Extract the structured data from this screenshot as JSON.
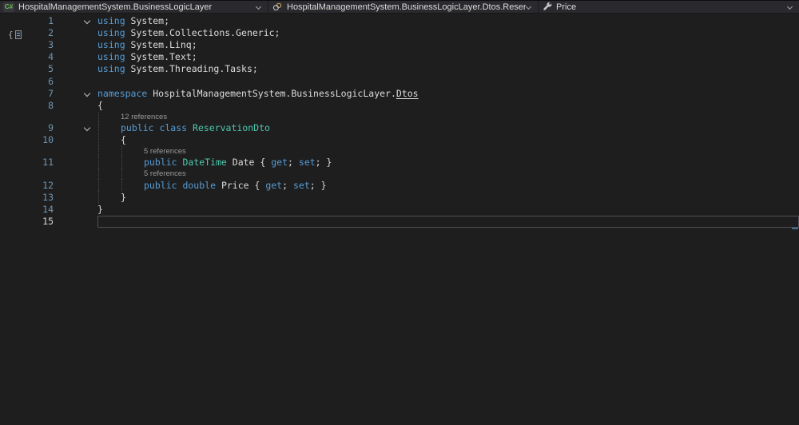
{
  "navbar": {
    "sections": [
      {
        "name": "project",
        "icon": "csharp-project-icon",
        "label": "HospitalManagementSystem.BusinessLogicLayer"
      },
      {
        "name": "type",
        "icon": "class-icon",
        "label": "HospitalManagementSystem.BusinessLogicLayer.Dtos.Reservation"
      },
      {
        "name": "member",
        "icon": "property-wrench-icon",
        "label": "Price"
      }
    ]
  },
  "editor": {
    "colors": {
      "background": "#1E1E1E",
      "keyword": "#569CD6",
      "type": "#4EC9B0",
      "plain": "#DCDCDC",
      "codelens": "#9A9A9A",
      "lineNumber": "#7096B0",
      "activeLineNumber": "#D4D4D4",
      "currentLineBorder": "#4F4F56"
    },
    "rows": [
      {
        "line": "1",
        "fold": true,
        "guides": 0,
        "tokens": [
          {
            "t": "using ",
            "c": "keyword"
          },
          {
            "t": "System;",
            "c": "plain"
          }
        ]
      },
      {
        "line": "2",
        "guides": 0,
        "tokens": [
          {
            "t": "using ",
            "c": "keyword"
          },
          {
            "t": "System.Collections.Generic;",
            "c": "plain"
          }
        ]
      },
      {
        "line": "3",
        "guides": 0,
        "tokens": [
          {
            "t": "using ",
            "c": "keyword"
          },
          {
            "t": "System.Linq;",
            "c": "plain"
          }
        ]
      },
      {
        "line": "4",
        "guides": 0,
        "tokens": [
          {
            "t": "using ",
            "c": "keyword"
          },
          {
            "t": "System.Text;",
            "c": "plain"
          }
        ]
      },
      {
        "line": "5",
        "guides": 0,
        "tokens": [
          {
            "t": "using ",
            "c": "keyword"
          },
          {
            "t": "System.Threading.Tasks;",
            "c": "plain"
          }
        ]
      },
      {
        "line": "6",
        "guides": 0,
        "tokens": []
      },
      {
        "line": "7",
        "fold": true,
        "guides": 0,
        "tokens": [
          {
            "t": "namespace ",
            "c": "keyword"
          },
          {
            "t": "HospitalManagementSystem.BusinessLogicLayer.",
            "c": "plain"
          },
          {
            "t": "Dtos",
            "c": "plain",
            "u": true
          }
        ]
      },
      {
        "line": "8",
        "guides": 0,
        "tokens": [
          {
            "t": "{",
            "c": "plain"
          }
        ]
      },
      {
        "kind": "codelens",
        "guides": 1,
        "text": "12 references"
      },
      {
        "line": "9",
        "fold": true,
        "guides": 1,
        "tokens": [
          {
            "t": "public class ",
            "c": "keyword"
          },
          {
            "t": "ReservationDto",
            "c": "type"
          }
        ]
      },
      {
        "line": "10",
        "guides": 1,
        "tokens": [
          {
            "t": "{",
            "c": "plain"
          }
        ]
      },
      {
        "kind": "codelens",
        "guides": 2,
        "text": "5 references"
      },
      {
        "line": "11",
        "guides": 2,
        "tokens": [
          {
            "t": "public ",
            "c": "keyword"
          },
          {
            "t": "DateTime",
            "c": "type"
          },
          {
            "t": " Date { ",
            "c": "plain"
          },
          {
            "t": "get",
            "c": "keyword"
          },
          {
            "t": "; ",
            "c": "plain"
          },
          {
            "t": "set",
            "c": "keyword"
          },
          {
            "t": "; }",
            "c": "plain"
          }
        ]
      },
      {
        "kind": "codelens",
        "guides": 2,
        "text": "5 references"
      },
      {
        "line": "12",
        "guides": 2,
        "tokens": [
          {
            "t": "public double",
            "c": "keyword"
          },
          {
            "t": " Price { ",
            "c": "plain"
          },
          {
            "t": "get",
            "c": "keyword"
          },
          {
            "t": "; ",
            "c": "plain"
          },
          {
            "t": "set",
            "c": "keyword"
          },
          {
            "t": "; }",
            "c": "plain"
          }
        ]
      },
      {
        "line": "13",
        "guides": 1,
        "tokens": [
          {
            "t": "}",
            "c": "plain"
          }
        ]
      },
      {
        "line": "14",
        "guides": 0,
        "tokens": [
          {
            "t": "}",
            "c": "plain"
          }
        ]
      },
      {
        "line": "15",
        "guides": 0,
        "current": true,
        "tokens": []
      }
    ]
  }
}
